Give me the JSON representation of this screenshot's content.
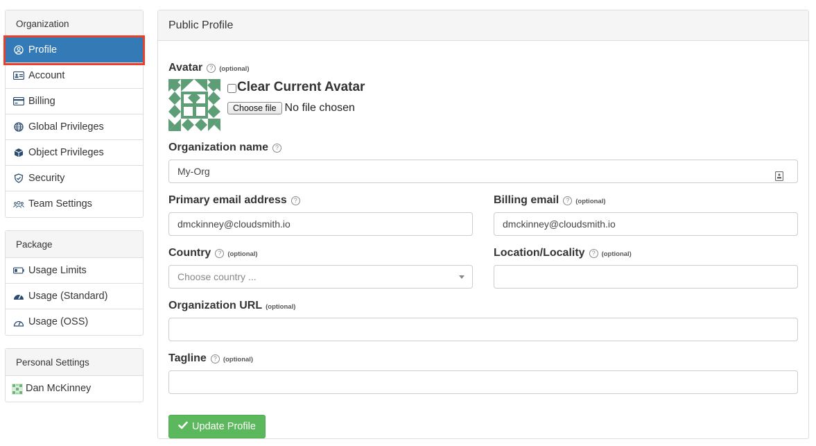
{
  "sidebar": {
    "organization": {
      "heading": "Organization",
      "items": [
        {
          "label": "Profile",
          "icon": "user-circle-icon"
        },
        {
          "label": "Account",
          "icon": "id-card-icon"
        },
        {
          "label": "Billing",
          "icon": "credit-card-icon"
        },
        {
          "label": "Global Privileges",
          "icon": "globe-icon"
        },
        {
          "label": "Object Privileges",
          "icon": "cube-icon"
        },
        {
          "label": "Security",
          "icon": "shield-check-icon"
        },
        {
          "label": "Team Settings",
          "icon": "users-icon"
        }
      ]
    },
    "package": {
      "heading": "Package",
      "items": [
        {
          "label": "Usage Limits",
          "icon": "battery-icon"
        },
        {
          "label": "Usage (Standard)",
          "icon": "gauge-icon"
        },
        {
          "label": "Usage (OSS)",
          "icon": "gauge-outline-icon"
        }
      ]
    },
    "personal": {
      "heading": "Personal Settings",
      "items": [
        {
          "label": "Dan McKinney",
          "icon": "avatar-icon"
        }
      ]
    }
  },
  "main": {
    "heading": "Public Profile",
    "avatar": {
      "label": "Avatar",
      "optional": "(optional)",
      "clear_label": "Clear Current Avatar",
      "choose_file": "Choose file",
      "no_file": "No file chosen",
      "color": "#5e9e76"
    },
    "org_name": {
      "label": "Organization name",
      "value": "My-Org"
    },
    "primary_email": {
      "label": "Primary email address",
      "value": "dmckinney@cloudsmith.io"
    },
    "billing_email": {
      "label": "Billing email",
      "optional": "(optional)",
      "value": "dmckinney@cloudsmith.io"
    },
    "country": {
      "label": "Country",
      "optional": "(optional)",
      "placeholder": "Choose country ..."
    },
    "location": {
      "label": "Location/Locality",
      "optional": "(optional)",
      "value": ""
    },
    "org_url": {
      "label": "Organization URL",
      "optional": "(optional)",
      "value": ""
    },
    "tagline": {
      "label": "Tagline",
      "optional": "(optional)",
      "value": ""
    },
    "submit_label": "Update Profile"
  },
  "colors": {
    "active": "#337ab7",
    "highlight": "#e8402a",
    "success": "#5cb85c"
  }
}
